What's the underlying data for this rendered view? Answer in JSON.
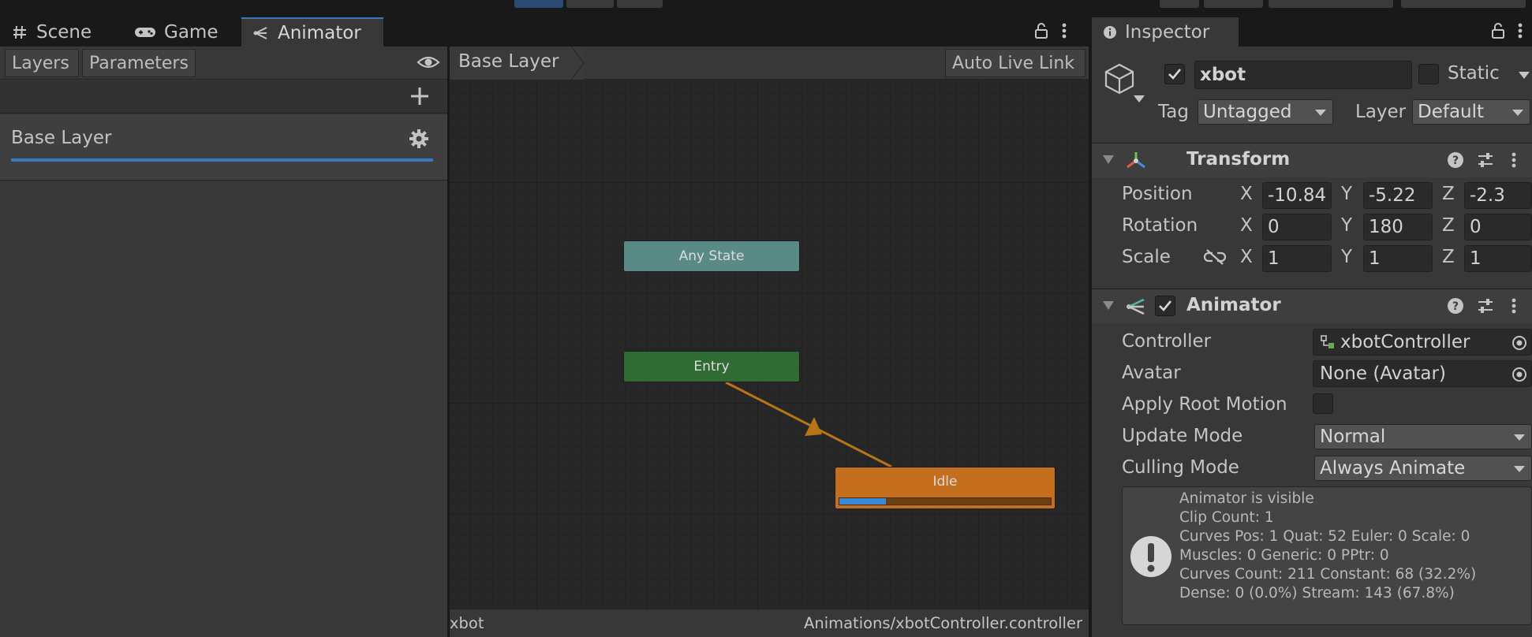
{
  "tabs_left": {
    "scene": "Scene",
    "game": "Game",
    "animator": "Animator"
  },
  "tabs_right": {
    "inspector": "Inspector"
  },
  "animator": {
    "layers_tab": "Layers",
    "parameters_tab": "Parameters",
    "layer_name": "Base Layer",
    "breadcrumb": "Base Layer",
    "auto_live_link": "Auto Live Link",
    "states": {
      "any_state": "Any State",
      "entry": "Entry",
      "idle": "Idle"
    },
    "idle_progress": 0.22,
    "footer_left": "xbot",
    "footer_right": "Animations/xbotController.controller"
  },
  "inspector": {
    "object_name": "xbot",
    "active": true,
    "static_label": "Static",
    "static_checked": false,
    "tag_label": "Tag",
    "tag_value": "Untagged",
    "layer_label": "Layer",
    "layer_value": "Default",
    "transform": {
      "title": "Transform",
      "position_label": "Position",
      "rotation_label": "Rotation",
      "scale_label": "Scale",
      "x": "X",
      "y": "Y",
      "z": "Z",
      "position": [
        "-10.84",
        "-5.22",
        "-2.3"
      ],
      "rotation": [
        "0",
        "180",
        "0"
      ],
      "scale": [
        "1",
        "1",
        "1"
      ]
    },
    "animator_component": {
      "title": "Animator",
      "enabled": true,
      "controller_label": "Controller",
      "controller_value": "xbotController",
      "avatar_label": "Avatar",
      "avatar_value": "None (Avatar)",
      "apply_root_motion_label": "Apply Root Motion",
      "update_mode_label": "Update Mode",
      "update_mode_value": "Normal",
      "culling_mode_label": "Culling Mode",
      "culling_mode_value": "Always Animate",
      "info_lines": [
        "Animator is visible",
        "Clip Count: 1",
        "Curves Pos: 1 Quat: 52 Euler: 0 Scale: 0",
        "Muscles: 0 Generic: 0 PPtr: 0",
        "Curves Count: 211 Constant: 68 (32.2%)",
        "Dense: 0 (0.0%) Stream: 143 (67.8%)"
      ]
    }
  },
  "colors": {
    "accent": "#3a79bb",
    "any_state": "#5a8a85",
    "entry": "#2f6b33",
    "idle": "#c46f1e",
    "transition": "#b87418"
  }
}
